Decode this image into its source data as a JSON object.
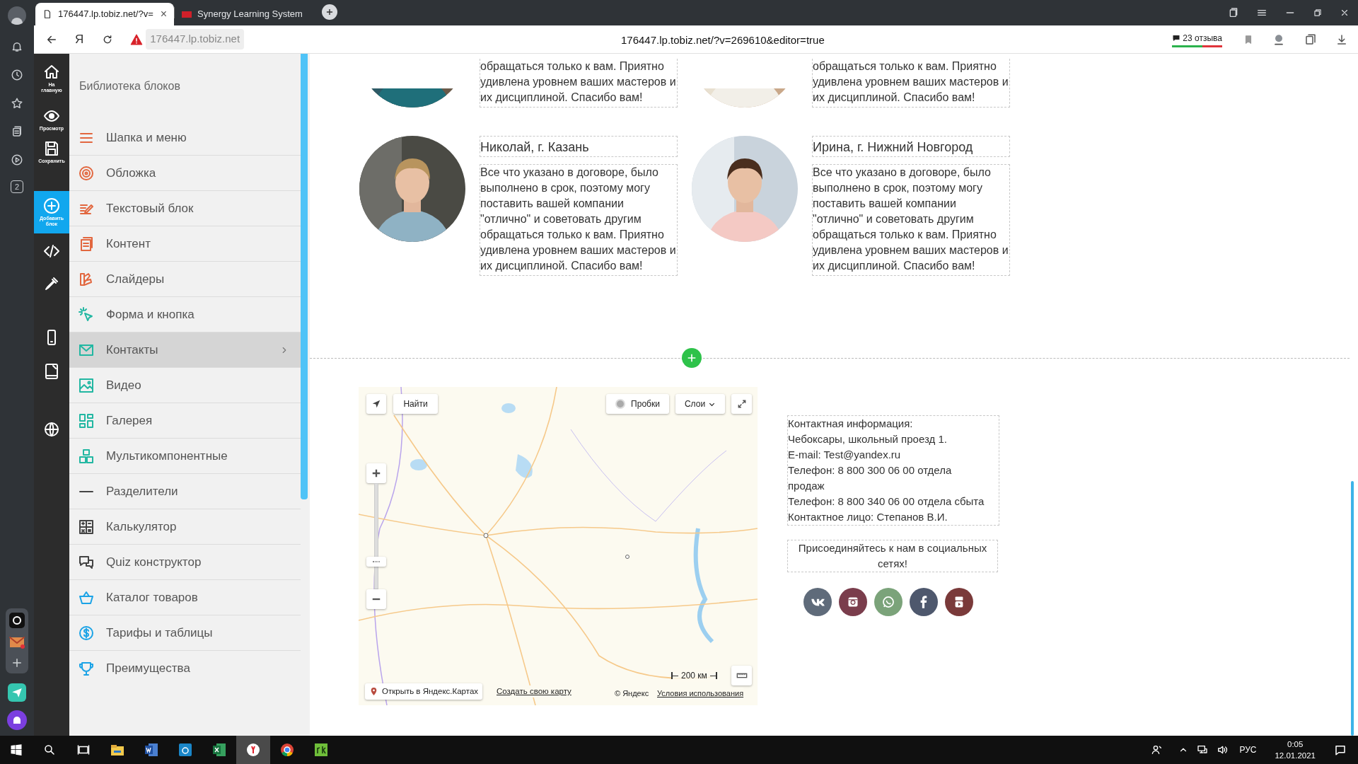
{
  "browser": {
    "tabs": [
      {
        "title": "176447.lp.tobiz.net/?v=",
        "close": "×",
        "selected": true
      },
      {
        "title": "Synergy Learning System",
        "selected": false
      }
    ],
    "yandex_button": "Я",
    "domain": "176447.lp.tobiz.net",
    "url": "176447.lp.tobiz.net/?v=269610&editor=true",
    "reviews": "23 отзыва",
    "sidebar_badge": "2"
  },
  "editor_toolbar": [
    {
      "kind": "home",
      "label": "На главную",
      "selected": false
    },
    {
      "kind": "preview",
      "label": "Просмотр",
      "selected": false
    },
    {
      "kind": "save",
      "label": "Сохранить",
      "selected": false
    },
    {
      "kind": "add",
      "label": "Добавить блок",
      "selected": true
    },
    {
      "kind": "code",
      "selected": false
    },
    {
      "kind": "pipette",
      "selected": false
    },
    {
      "kind": "phone",
      "selected": false
    },
    {
      "kind": "tablet",
      "selected": false
    },
    {
      "kind": "globe",
      "selected": false
    }
  ],
  "block_library": {
    "title": "Библиотека блоков",
    "items": [
      {
        "label": "Шапка и меню",
        "selected": false
      },
      {
        "label": "Обложка",
        "selected": false
      },
      {
        "label": "Текстовый блок",
        "selected": false
      },
      {
        "label": "Контент",
        "selected": false
      },
      {
        "label": "Слайдеры",
        "selected": false
      },
      {
        "label": "Форма и кнопка",
        "selected": false
      },
      {
        "label": "Контакты",
        "selected": true
      },
      {
        "label": "Видео",
        "selected": false
      },
      {
        "label": "Галерея",
        "selected": false
      },
      {
        "label": "Мультикомпонентные",
        "selected": false
      },
      {
        "label": "Разделители",
        "selected": false
      },
      {
        "label": "Калькулятор",
        "selected": false
      },
      {
        "label": "Quiz конструктор",
        "selected": false
      },
      {
        "label": "Каталог товаров",
        "selected": false
      },
      {
        "label": "Тарифы и таблицы",
        "selected": false
      },
      {
        "label": "Преимущества",
        "selected": false
      }
    ]
  },
  "testimonials": [
    {
      "text": "обращаться только к вам. Приятно удивлена уровнем ваших мастеров и их дисциплиной. Спасибо вам!"
    },
    {
      "text": "обращаться только к вам. Приятно удивлена уровнем ваших мастеров и их дисциплиной. Спасибо вам!"
    },
    {
      "name": "Николай, г. Казань",
      "text": "Все что указано в договоре, было выполнено в срок, поэтому могу поставить вашей компании \"отлично\" и советовать другим обращаться только к вам. Приятно удивлена уровнем ваших мастеров и их дисциплиной. Спасибо вам!"
    },
    {
      "name": "Ирина, г. Нижний Новгород",
      "text": "Все что указано в договоре, было выполнено в срок, поэтому могу поставить вашей компании \"отлично\" и советовать другим обращаться только к вам. Приятно удивлена уровнем ваших мастеров и их дисциплиной. Спасибо вам!"
    }
  ],
  "map": {
    "find": "Найти",
    "traffic": "Пробки",
    "layers": "Слои",
    "scale": "200 км",
    "open_link": "Открыть в Яндекс.Картах",
    "create_link": "Создать свою карту",
    "copyright": "© Яндекс",
    "terms_link": "Условия использования"
  },
  "contact_lines": [
    "Контактная информация:",
    "Чебоксары, школьный проезд 1.",
    "E-mail: Test@yandex.ru",
    "Телефон: 8 800 300 06 00 отдела продаж",
    "Телефон: 8 800 340 06 00 отдела сбыта",
    "Контактное лицо: Степанов В.И."
  ],
  "social_heading": "Присоединяйтесь к нам в социальных сетях!",
  "social": [
    {
      "kind": "vk",
      "color": "#5f6b7a"
    },
    {
      "kind": "instagram",
      "color": "#7a3d4c"
    },
    {
      "kind": "whatsapp",
      "color": "#7ba37a"
    },
    {
      "kind": "facebook",
      "color": "#4e586d"
    },
    {
      "kind": "youtube",
      "color": "#7a3a3a"
    }
  ],
  "taskbar": {
    "apps": [
      {
        "kind": "explorer",
        "selected": false
      },
      {
        "kind": "word",
        "selected": false
      },
      {
        "kind": "browser-blue",
        "selected": false
      },
      {
        "kind": "excel",
        "selected": false
      },
      {
        "kind": "yandex",
        "selected": true
      },
      {
        "kind": "chrome",
        "selected": false
      },
      {
        "kind": "rk",
        "selected": false
      }
    ],
    "language": "РУС",
    "time": "0:05",
    "date": "12.01.2021"
  }
}
